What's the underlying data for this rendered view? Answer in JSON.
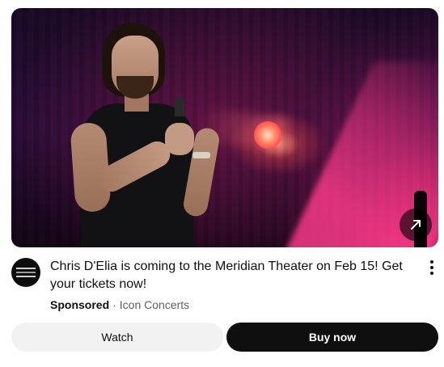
{
  "ad": {
    "title": "Chris D'Elia is coming to the Meridian Theater on Feb 15! Get your tickets now!",
    "sponsored_label": "Sponsored",
    "separator": "·",
    "advertiser": "Icon Concerts",
    "thumbnail_icon": "external-link-arrow-icon",
    "menu_icon": "more-vert-icon",
    "avatar_icon": "icon-concerts-logo"
  },
  "actions": {
    "watch_label": "Watch",
    "buy_label": "Buy now"
  },
  "colors": {
    "primary_button_bg": "#0f0f0f",
    "secondary_button_bg": "#f2f2f2",
    "meta_text": "#606060"
  }
}
